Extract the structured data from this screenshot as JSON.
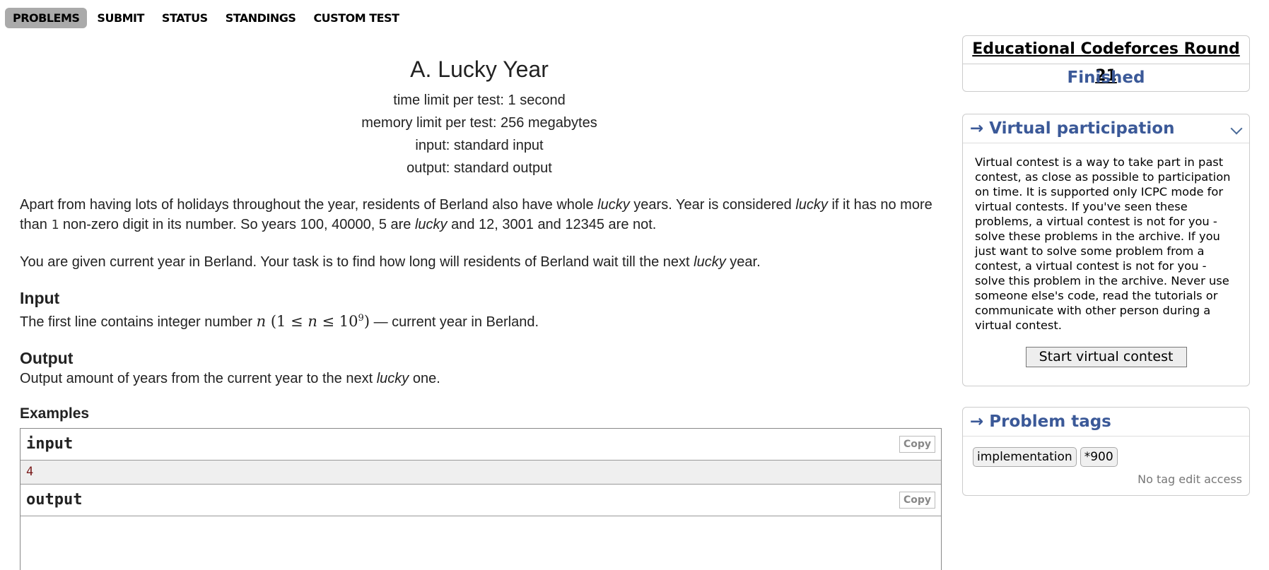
{
  "nav": [
    "PROBLEMS",
    "SUBMIT",
    "STATUS",
    "STANDINGS",
    "CUSTOM TEST"
  ],
  "problem": {
    "title": "A. Lucky Year",
    "time_limit": "time limit per test: 1 second",
    "memory_limit": "memory limit per test: 256 megabytes",
    "input": "input: standard input",
    "output": "output: standard output",
    "p1": {
      "a": "Apart from having lots of holidays throughout the year, residents of Berland also have whole ",
      "lucky1": "lucky",
      "b": " years. Year is considered ",
      "lucky2": "lucky",
      "c": " if it has no more than ",
      "one": "1",
      "d": " non-zero digit in its number. So years 100, 40000, 5 are ",
      "lucky3": "lucky",
      "e": " and 12, 3001 and 12345 are not."
    },
    "p2": {
      "a": "You are given current year in Berland. Your task is to find how long will residents of Berland wait till the next ",
      "lucky": "lucky",
      "b": " year."
    },
    "input_title": "Input",
    "input_text": {
      "a": "The first line contains integer number ",
      "n": "n",
      "math": "(1 ≤ ",
      "n2": "n",
      "math2": " ≤ 10",
      "exp": "9",
      "math3": ")",
      "b": " — current year in Berland."
    },
    "output_title": "Output",
    "output_text": {
      "a": "Output amount of years from the current year to the next ",
      "lucky": "lucky",
      "b": " one."
    },
    "examples_title": "Examples",
    "example": {
      "input_label": "input",
      "input_value": "4",
      "output_label": "output",
      "copy": "Copy"
    }
  },
  "sidebar": {
    "contest_name": "Educational Codeforces Round 21",
    "contest_status": "Finished",
    "virtual": {
      "caption": "→ Virtual participation",
      "text": "Virtual contest is a way to take part in past contest, as close as possible to participation on time. It is supported only ICPC mode for virtual contests. If you've seen these problems, a virtual contest is not for you - solve these problems in the archive. If you just want to solve some problem from a contest, a virtual contest is not for you - solve this problem in the archive. Never use someone else's code, read the tutorials or communicate with other person during a virtual contest.",
      "button": "Start virtual contest"
    },
    "tags": {
      "caption": "→ Problem tags",
      "items": [
        "implementation",
        "*900"
      ],
      "no_access": "No tag edit access"
    }
  }
}
